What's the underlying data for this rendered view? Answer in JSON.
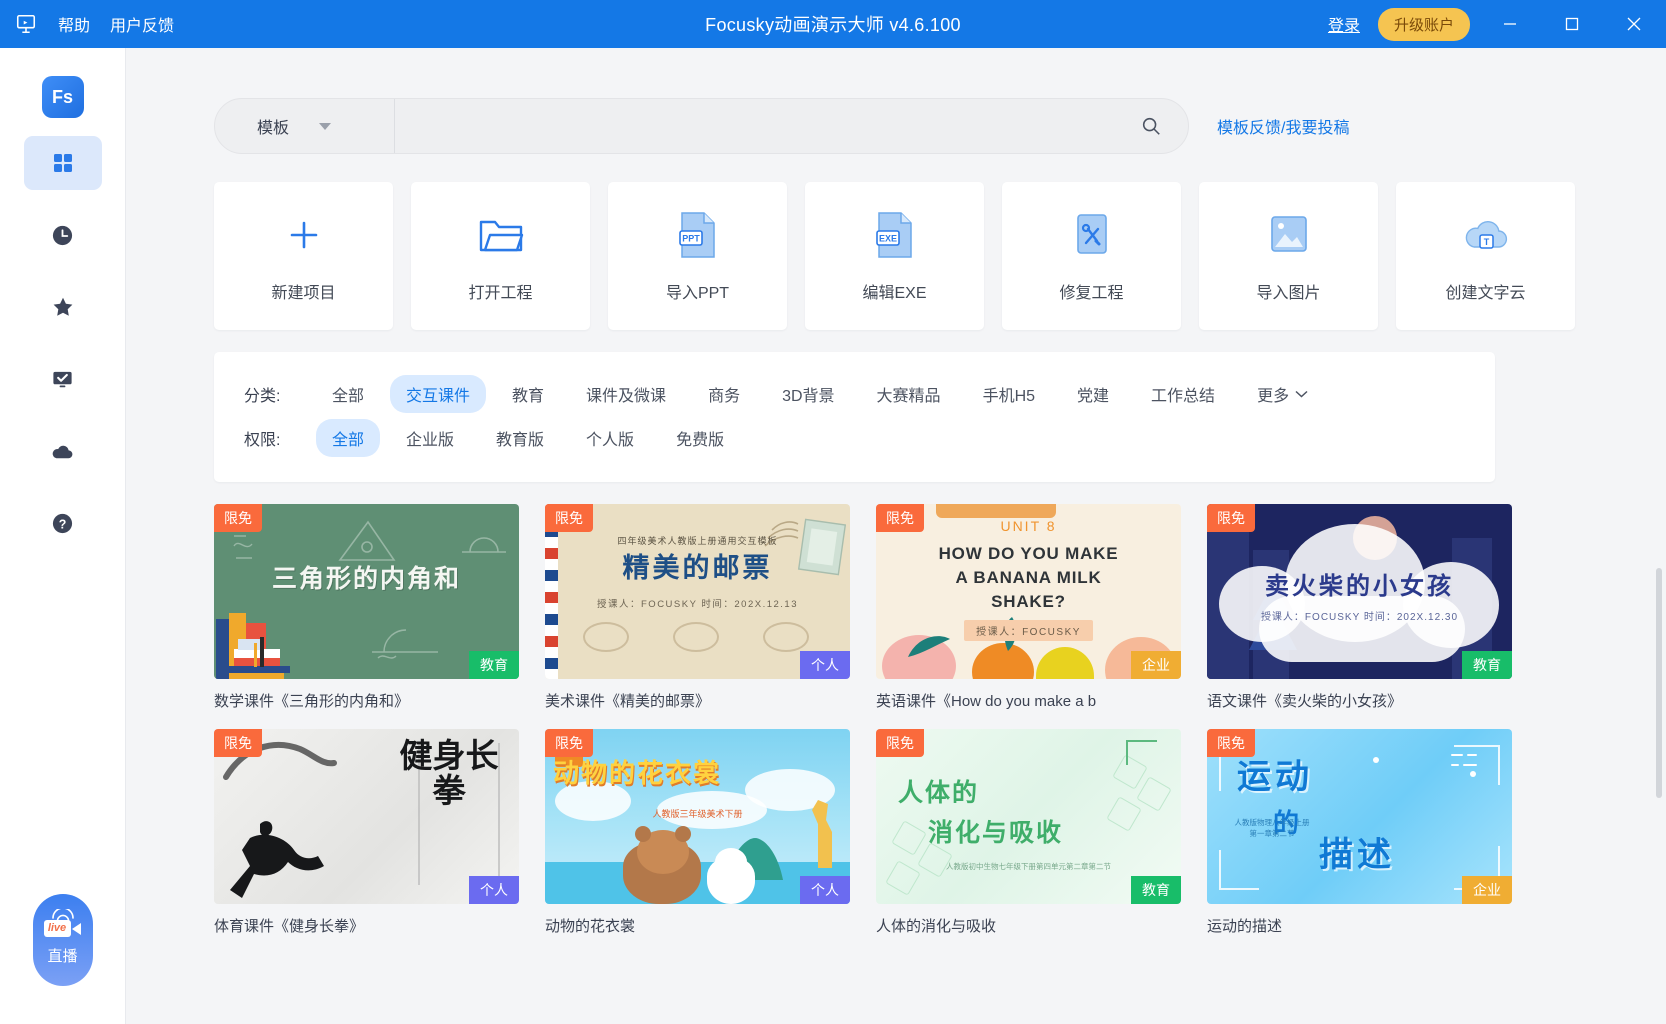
{
  "titlebar": {
    "logo_icon": "projector-icon",
    "menu": [
      {
        "label": "帮助",
        "name": "help"
      },
      {
        "label": "用户反馈",
        "name": "user-feedback"
      }
    ],
    "title": "Focusky动画演示大师 v4.6.100",
    "login_label": "登录",
    "upgrade_label": "升级账户",
    "upgrade_color": "#f5c451",
    "window_controls": [
      "minimize-icon",
      "maximize-icon",
      "close-icon"
    ]
  },
  "sidebar": {
    "logo_text": "Fs",
    "items": [
      {
        "name": "templates",
        "icon": "grid-icon",
        "active": true
      },
      {
        "name": "recent",
        "icon": "clock-icon",
        "active": false
      },
      {
        "name": "favorites",
        "icon": "star-icon",
        "active": false
      },
      {
        "name": "my-projects",
        "icon": "monitor-check-icon",
        "active": false
      },
      {
        "name": "cloud",
        "icon": "cloud-icon",
        "active": false
      },
      {
        "name": "help",
        "icon": "question-circle-icon",
        "active": false
      }
    ],
    "live": {
      "icon": "live-camera-icon",
      "badge": "live",
      "label": "直播"
    }
  },
  "search": {
    "category_label": "模板",
    "value": "",
    "placeholder": "",
    "search_icon": "search-icon",
    "feedback_link": "模板反馈/我要投稿"
  },
  "actions": [
    {
      "label": "新建项目",
      "icon": "plus-icon"
    },
    {
      "label": "打开工程",
      "icon": "folder-open-icon"
    },
    {
      "label": "导入PPT",
      "icon": "ppt-file-icon"
    },
    {
      "label": "编辑EXE",
      "icon": "exe-file-icon"
    },
    {
      "label": "修复工程",
      "icon": "wrench-tools-icon"
    },
    {
      "label": "导入图片",
      "icon": "image-icon"
    },
    {
      "label": "创建文字云",
      "icon": "text-cloud-icon"
    }
  ],
  "filters": {
    "category": {
      "label": "分类:",
      "items": [
        "全部",
        "交互课件",
        "教育",
        "课件及微课",
        "商务",
        "3D背景",
        "大赛精品",
        "手机H5",
        "党建",
        "工作总结"
      ],
      "active": "交互课件",
      "more_label": "更多"
    },
    "permission": {
      "label": "权限:",
      "items": [
        "全部",
        "企业版",
        "教育版",
        "个人版",
        "免费版"
      ],
      "active": "全部"
    }
  },
  "templates": [
    {
      "title": "数学课件《三角形的内角和》",
      "free_badge": "限免",
      "right_badge": "教育",
      "right_badge_color": "#18bd69",
      "thumb_title": "三角形的内角和",
      "thumb_sub": "",
      "thumb_meta": ""
    },
    {
      "title": "美术课件《精美的邮票》",
      "free_badge": "限免",
      "right_badge": "个人",
      "right_badge_color": "#6b6bf0",
      "thumb_title": "精美的邮票",
      "thumb_sub": "四年级美术人教版上册通用交互模板",
      "thumb_meta": "授课人：FOCUSKY    时间：202X.12.13"
    },
    {
      "title": "英语课件《How do you make a b",
      "free_badge": "限免",
      "right_badge": "企业",
      "right_badge_color": "#f0ad33",
      "thumb_unit": "UNIT 8",
      "thumb_line1": "HOW DO YOU MAKE",
      "thumb_line2": "A BANANA MILK",
      "thumb_line3": "SHAKE?",
      "thumb_meta": "授课人：FOCUSKY"
    },
    {
      "title": "语文课件《卖火柴的小女孩》",
      "free_badge": "限免",
      "right_badge": "教育",
      "right_badge_color": "#18bd69",
      "thumb_title": "卖火柴的小女孩",
      "thumb_meta": "授课人：FOCUSKY     时间：202X.12.30"
    },
    {
      "title": "体育课件《健身长拳》",
      "free_badge": "限免",
      "right_badge": "个人",
      "right_badge_color": "#6b6bf0",
      "thumb_title": "健身长拳"
    },
    {
      "title": "动物的花衣裳",
      "free_badge": "限免",
      "right_badge": "个人",
      "right_badge_color": "#6b6bf0",
      "thumb_title": "动物的花衣裳",
      "thumb_sub": "人教版三年级美术下册"
    },
    {
      "title": "人体的消化与吸收",
      "free_badge": "限免",
      "right_badge": "教育",
      "right_badge_color": "#18bd69",
      "thumb_l1": "人体的",
      "thumb_l2": "消化与吸收",
      "thumb_sub": "人教版初中生物七年级下册第四单元第二章第二节"
    },
    {
      "title": "运动的描述",
      "free_badge": "限免",
      "right_badge": "企业",
      "right_badge_color": "#f0ad33",
      "thumb_l1": "运动",
      "thumb_l2": "的",
      "thumb_l3": "描述",
      "thumb_sub": "人教版物理八年级上册第一章第二节"
    }
  ]
}
